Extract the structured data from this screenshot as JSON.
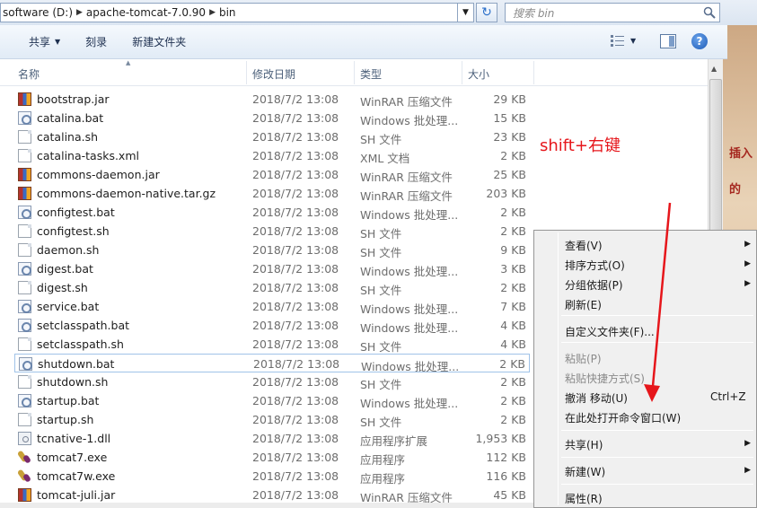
{
  "address": {
    "crumbs": [
      "software (D:)",
      "apache-tomcat-7.0.90",
      "bin"
    ],
    "search_placeholder": "搜索 bin"
  },
  "toolbar": {
    "share_label": "共享",
    "burn_label": "刻录",
    "new_folder_label": "新建文件夹"
  },
  "columns": {
    "name": "名称",
    "date": "修改日期",
    "type": "类型",
    "size": "大小"
  },
  "files": [
    {
      "name": "bootstrap.jar",
      "date": "2018/7/2 13:08",
      "type": "WinRAR 压缩文件",
      "size": "29 KB",
      "icon": "rar"
    },
    {
      "name": "catalina.bat",
      "date": "2018/7/2 13:08",
      "type": "Windows 批处理...",
      "size": "15 KB",
      "icon": "bat"
    },
    {
      "name": "catalina.sh",
      "date": "2018/7/2 13:08",
      "type": "SH 文件",
      "size": "23 KB",
      "icon": "doc"
    },
    {
      "name": "catalina-tasks.xml",
      "date": "2018/7/2 13:08",
      "type": "XML 文档",
      "size": "2 KB",
      "icon": "doc"
    },
    {
      "name": "commons-daemon.jar",
      "date": "2018/7/2 13:08",
      "type": "WinRAR 压缩文件",
      "size": "25 KB",
      "icon": "rar"
    },
    {
      "name": "commons-daemon-native.tar.gz",
      "date": "2018/7/2 13:08",
      "type": "WinRAR 压缩文件",
      "size": "203 KB",
      "icon": "rar"
    },
    {
      "name": "configtest.bat",
      "date": "2018/7/2 13:08",
      "type": "Windows 批处理...",
      "size": "2 KB",
      "icon": "bat"
    },
    {
      "name": "configtest.sh",
      "date": "2018/7/2 13:08",
      "type": "SH 文件",
      "size": "2 KB",
      "icon": "doc"
    },
    {
      "name": "daemon.sh",
      "date": "2018/7/2 13:08",
      "type": "SH 文件",
      "size": "9 KB",
      "icon": "doc"
    },
    {
      "name": "digest.bat",
      "date": "2018/7/2 13:08",
      "type": "Windows 批处理...",
      "size": "3 KB",
      "icon": "bat"
    },
    {
      "name": "digest.sh",
      "date": "2018/7/2 13:08",
      "type": "SH 文件",
      "size": "2 KB",
      "icon": "doc"
    },
    {
      "name": "service.bat",
      "date": "2018/7/2 13:08",
      "type": "Windows 批处理...",
      "size": "7 KB",
      "icon": "bat"
    },
    {
      "name": "setclasspath.bat",
      "date": "2018/7/2 13:08",
      "type": "Windows 批处理...",
      "size": "4 KB",
      "icon": "bat"
    },
    {
      "name": "setclasspath.sh",
      "date": "2018/7/2 13:08",
      "type": "SH 文件",
      "size": "4 KB",
      "icon": "doc"
    },
    {
      "name": "shutdown.bat",
      "date": "2018/7/2 13:08",
      "type": "Windows 批处理...",
      "size": "2 KB",
      "icon": "bat",
      "selected": true
    },
    {
      "name": "shutdown.sh",
      "date": "2018/7/2 13:08",
      "type": "SH 文件",
      "size": "2 KB",
      "icon": "doc"
    },
    {
      "name": "startup.bat",
      "date": "2018/7/2 13:08",
      "type": "Windows 批处理...",
      "size": "2 KB",
      "icon": "bat"
    },
    {
      "name": "startup.sh",
      "date": "2018/7/2 13:08",
      "type": "SH 文件",
      "size": "2 KB",
      "icon": "doc"
    },
    {
      "name": "tcnative-1.dll",
      "date": "2018/7/2 13:08",
      "type": "应用程序扩展",
      "size": "1,953 KB",
      "icon": "dll"
    },
    {
      "name": "tomcat7.exe",
      "date": "2018/7/2 13:08",
      "type": "应用程序",
      "size": "112 KB",
      "icon": "exe"
    },
    {
      "name": "tomcat7w.exe",
      "date": "2018/7/2 13:08",
      "type": "应用程序",
      "size": "116 KB",
      "icon": "exe"
    },
    {
      "name": "tomcat-juli.jar",
      "date": "2018/7/2 13:08",
      "type": "WinRAR 压缩文件",
      "size": "45 KB",
      "icon": "rar"
    }
  ],
  "annotation": "shift+右键",
  "context_menu": {
    "view": "查看(V)",
    "sort": "排序方式(O)",
    "group": "分组依据(P)",
    "refresh": "刷新(E)",
    "customize": "自定义文件夹(F)...",
    "paste": "粘贴(P)",
    "paste_shortcut": "粘贴快捷方式(S)",
    "undo_move": "撤消 移动(U)",
    "undo_shortcut": "Ctrl+Z",
    "open_cmd": "在此处打开命令窗口(W)",
    "share": "共享(H)",
    "new": "新建(W)",
    "properties": "属性(R)"
  },
  "background_text": {
    "line1": "插入",
    "line2": "的"
  },
  "colors": {
    "annotation_red": "#e6161b",
    "selection_border": "#a0c3e8"
  }
}
